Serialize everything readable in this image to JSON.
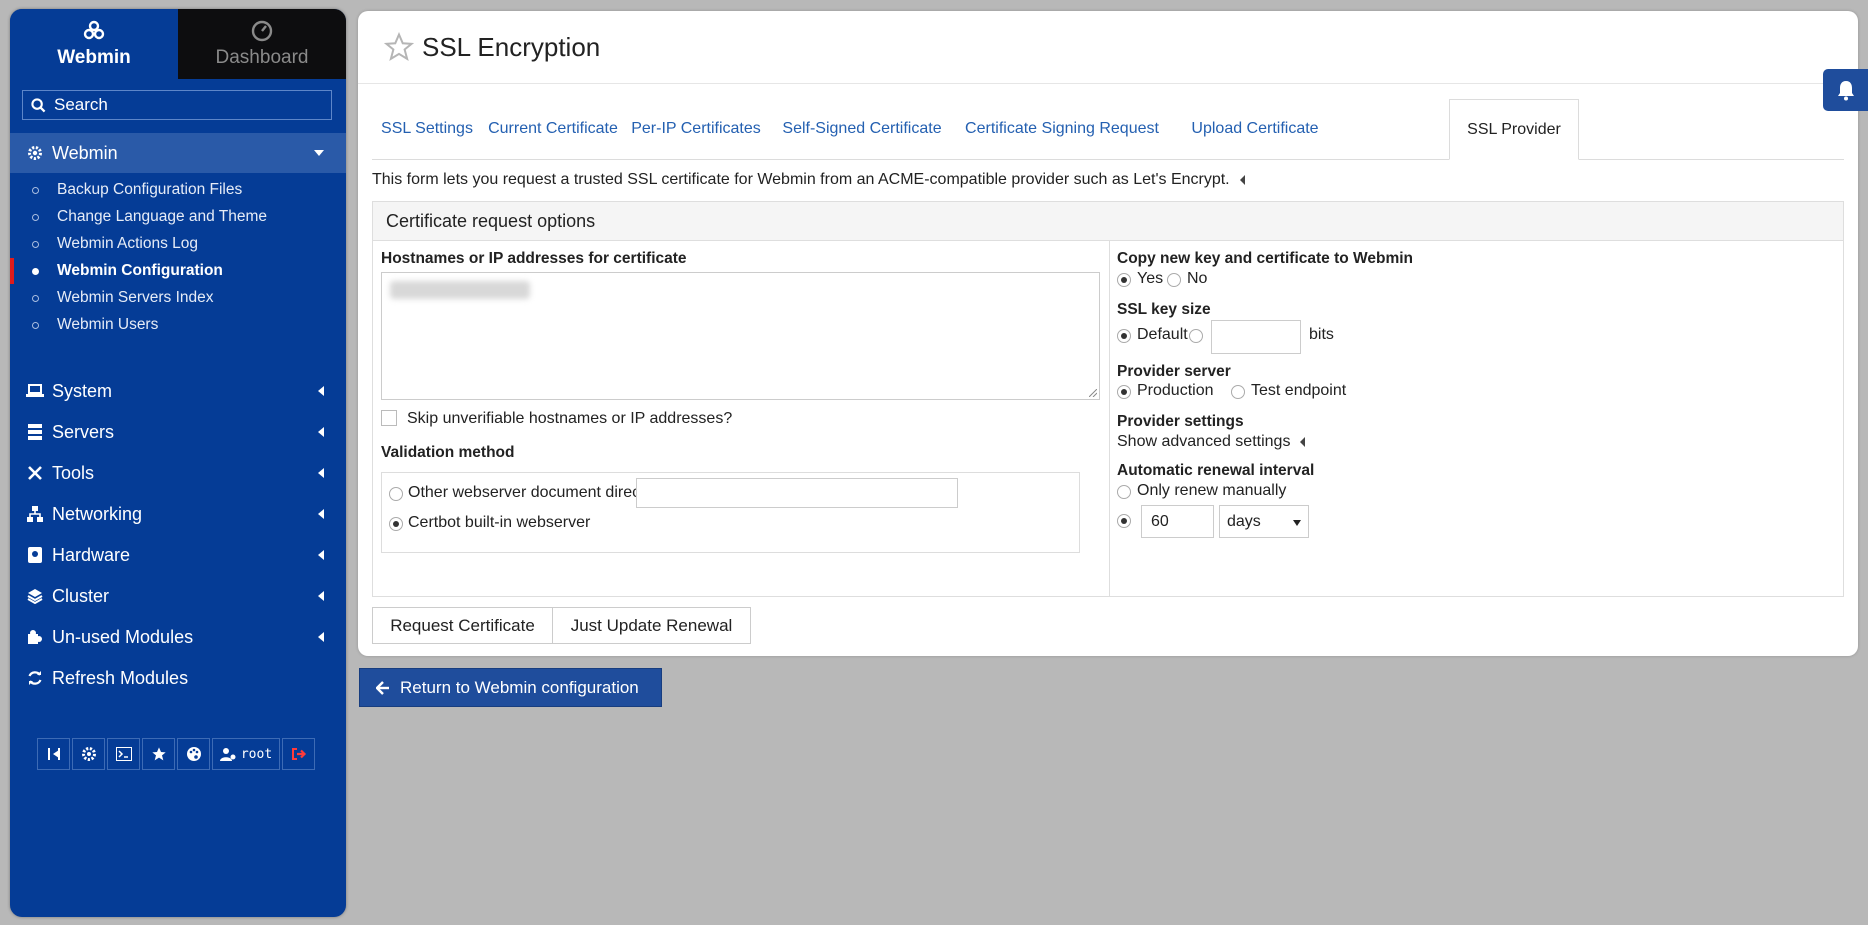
{
  "sidebar": {
    "top_tabs": [
      {
        "label": "Webmin",
        "icon": "webmin-logo-icon"
      },
      {
        "label": "Dashboard",
        "icon": "dashboard-gauge-icon"
      }
    ],
    "search_placeholder": "Search",
    "webmin_section": {
      "label": "Webmin",
      "items": [
        {
          "label": "Backup Configuration Files"
        },
        {
          "label": "Change Language and Theme"
        },
        {
          "label": "Webmin Actions Log"
        },
        {
          "label": "Webmin Configuration"
        },
        {
          "label": "Webmin Servers Index"
        },
        {
          "label": "Webmin Users"
        }
      ]
    },
    "sections": [
      {
        "label": "System"
      },
      {
        "label": "Servers"
      },
      {
        "label": "Tools"
      },
      {
        "label": "Networking"
      },
      {
        "label": "Hardware"
      },
      {
        "label": "Cluster"
      },
      {
        "label": "Un-used Modules"
      }
    ],
    "refresh_label": "Refresh Modules",
    "user_label": "root"
  },
  "page": {
    "title": "SSL Encryption",
    "tabs": [
      {
        "label": "SSL Settings"
      },
      {
        "label": "Current Certificate"
      },
      {
        "label": "Per-IP Certificates"
      },
      {
        "label": "Self-Signed Certificate"
      },
      {
        "label": "Certificate Signing Request"
      },
      {
        "label": "Upload Certificate"
      },
      {
        "label": "SSL Provider"
      }
    ],
    "description": "This form lets you request a trusted SSL certificate for Webmin from an ACME-compatible provider such as Let's Encrypt.",
    "form": {
      "heading": "Certificate request options",
      "hostnames_label": "Hostnames or IP addresses for certificate",
      "skip_label": "Skip unverifiable hostnames or IP addresses?",
      "validation_label": "Validation method",
      "validation_options": [
        {
          "label": "Other webserver document directory",
          "selected": false
        },
        {
          "label": "Certbot built-in webserver",
          "selected": true
        }
      ],
      "copy_label": "Copy new key and certificate to Webmin",
      "copy_yes": "Yes",
      "copy_no": "No",
      "keysize_label": "SSL key size",
      "keysize_default": "Default",
      "keysize_unit": "bits",
      "provider_label": "Provider server",
      "provider_production": "Production",
      "provider_test": "Test endpoint",
      "provider_settings_label": "Provider settings",
      "advanced_link": "Show advanced settings",
      "renewal_label": "Automatic renewal interval",
      "renewal_manual": "Only renew manually",
      "renewal_value": "60",
      "renewal_unit": "days"
    },
    "buttons": {
      "request": "Request Certificate",
      "update": "Just Update Renewal"
    },
    "return_label": "Return to Webmin configuration"
  }
}
